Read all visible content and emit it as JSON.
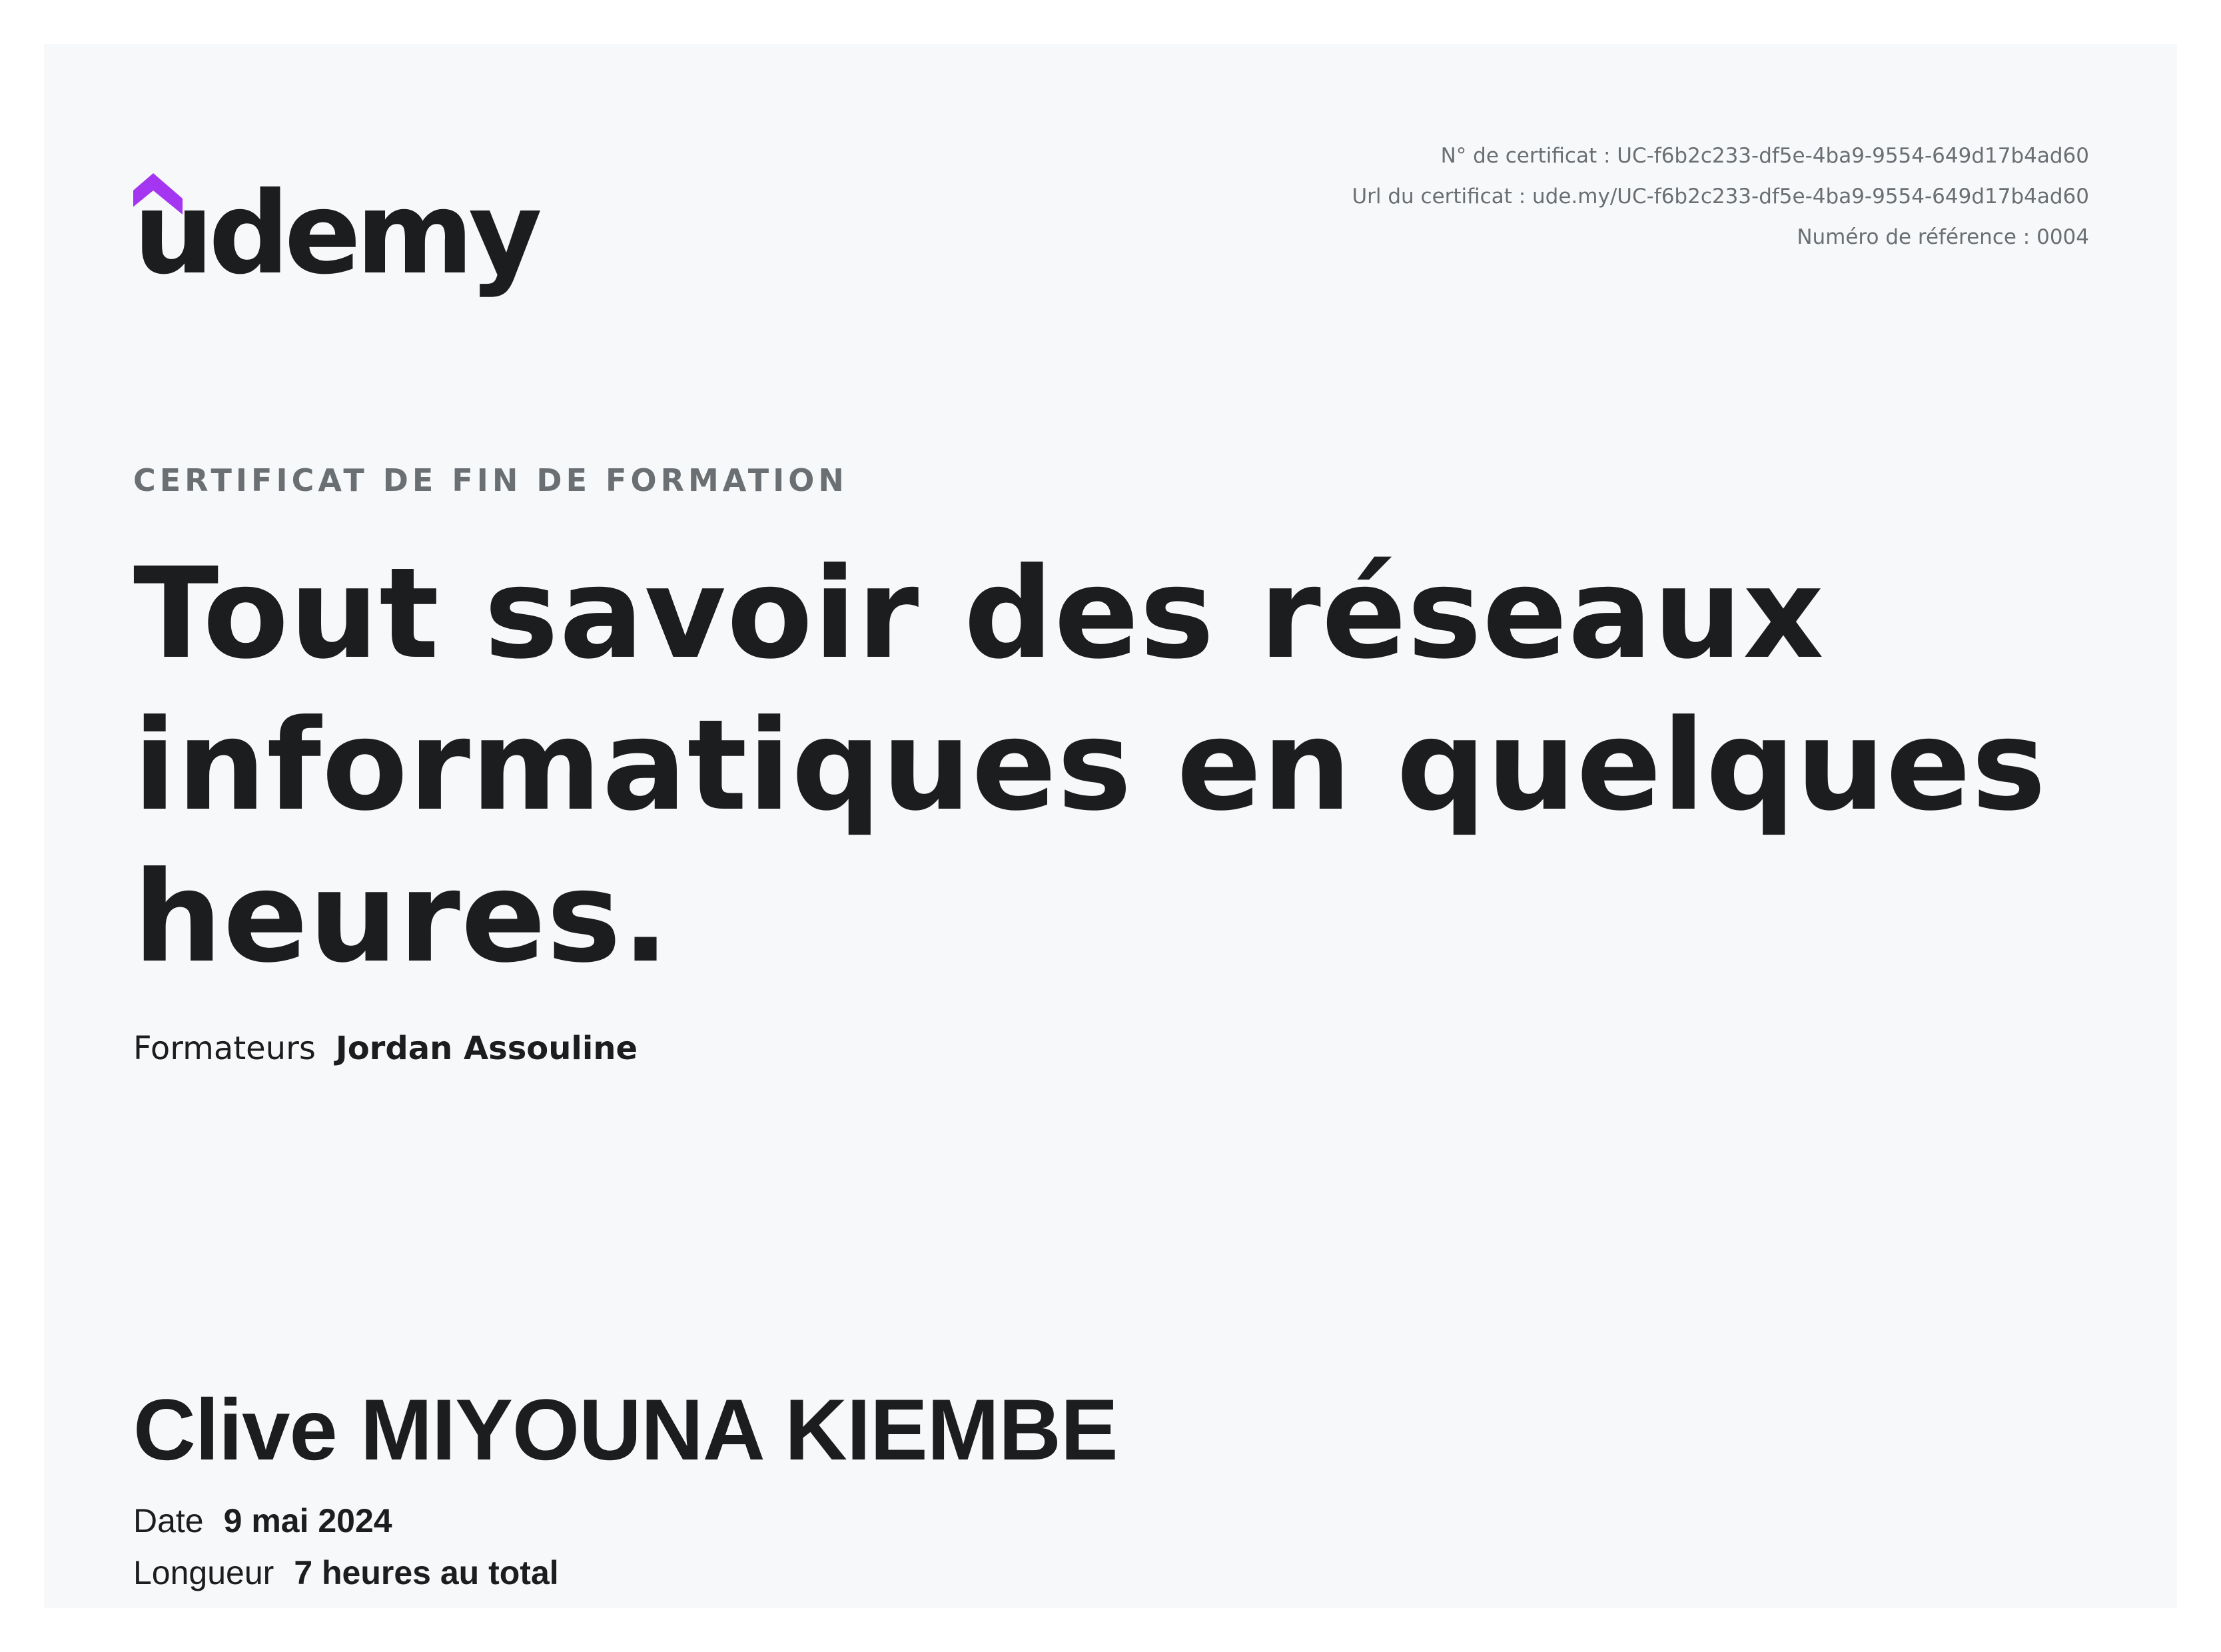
{
  "brand": {
    "name": "udemy",
    "accent_color": "#a435f0",
    "text_color": "#1c1d1f"
  },
  "meta": {
    "certificate_number": "N° de certificat : UC-f6b2c233-df5e-4ba9-9554-649d17b4ad60",
    "certificate_url": "Url du certificat : ude.my/UC-f6b2c233-df5e-4ba9-9554-649d17b4ad60",
    "reference_number": "Numéro de référence : 0004"
  },
  "certificate": {
    "kicker": "CERTIFICAT DE FIN DE FORMATION",
    "course_title": "Tout savoir des réseaux informatiques en quelques heures.",
    "instructors_label": "Formateurs",
    "instructors_value": "Jordan Assouline",
    "recipient_name": "Clive MIYOUNA KIEMBE",
    "date_label": "Date",
    "date_value": "9 mai 2024",
    "length_label": "Longueur",
    "length_value": "7 heures au total"
  }
}
